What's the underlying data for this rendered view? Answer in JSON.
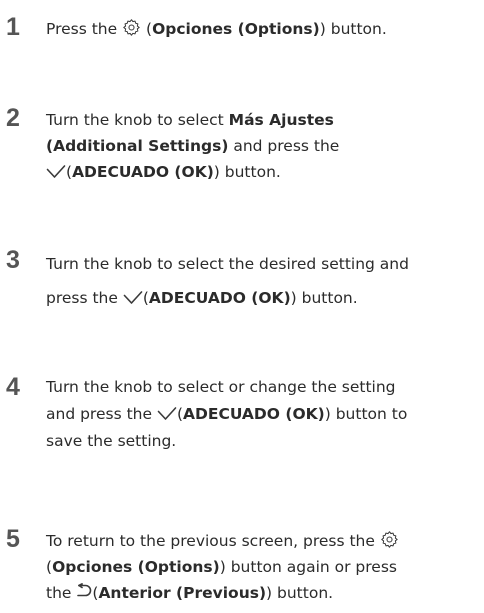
{
  "steps": [
    {
      "number": "1",
      "lines": [
        [
          "Press the ",
          {
            "icon": "gear-icon"
          },
          " (",
          {
            "b": "Opciones (Options)"
          },
          ") button."
        ]
      ]
    },
    {
      "number": "2",
      "lines": [
        [
          "Turn the knob to select ",
          {
            "b": "Más Ajustes"
          }
        ],
        [
          {
            "b": "(Additional Settings)"
          },
          " and press the"
        ],
        [
          {
            "icon": "check-icon"
          },
          "(",
          {
            "b": "ADECUADO (OK)"
          },
          ") button."
        ]
      ]
    },
    {
      "number": "3",
      "lines": [
        [
          "Turn the knob to select the desired setting and"
        ],
        [
          "press the ",
          {
            "icon": "check-icon"
          },
          "(",
          {
            "b": "ADECUADO (OK)"
          },
          ") button."
        ]
      ]
    },
    {
      "number": "4",
      "lines": [
        [
          "Turn the knob to select or change the setting"
        ],
        [
          "and press the ",
          {
            "icon": "check-icon"
          },
          "(",
          {
            "b": "ADECUADO (OK)"
          },
          ") button to"
        ],
        [
          "save the setting."
        ]
      ]
    },
    {
      "number": "5",
      "lines": [
        [
          "To return to the previous screen, press the ",
          {
            "icon": "gear-icon"
          }
        ],
        [
          "(",
          {
            "b": "Opciones (Options)"
          },
          ") button again or press"
        ],
        [
          "the ",
          {
            "icon": "back-arrow-icon"
          },
          "(",
          {
            "b": "Anterior (Previous)"
          },
          ") button."
        ]
      ]
    }
  ]
}
